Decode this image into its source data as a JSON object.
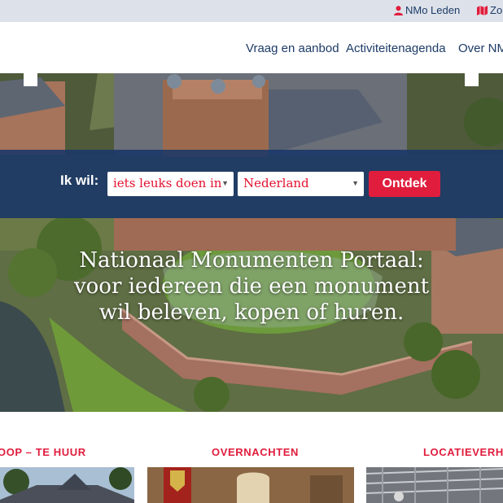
{
  "topbar": {
    "leden_label": "NMo Leden",
    "leden_icon": "user-icon",
    "zoek_label": "Zo",
    "zoek_icon": "map-icon"
  },
  "nav": {
    "items": [
      "Vraag en aanbod",
      "Activiteitenagenda",
      "Over NM"
    ]
  },
  "search": {
    "label": "Ik wil:",
    "what_selected": "iets leuks doen in",
    "where_selected": "Nederland",
    "submit_label": "Ontdek"
  },
  "hero": {
    "tagline": [
      "Nationaal Monumenten Portaal:",
      "voor iedereen die een monument",
      "wil beleven, kopen of huren."
    ]
  },
  "categories": [
    {
      "title": "OOP – TE HUUR"
    },
    {
      "title": "OVERNACHTEN"
    },
    {
      "title": "LOCATIEVERHU"
    }
  ],
  "colors": {
    "brand_red": "#e01d3d",
    "navy": "#1d3b68",
    "topbar_bg": "#dde2ea"
  }
}
